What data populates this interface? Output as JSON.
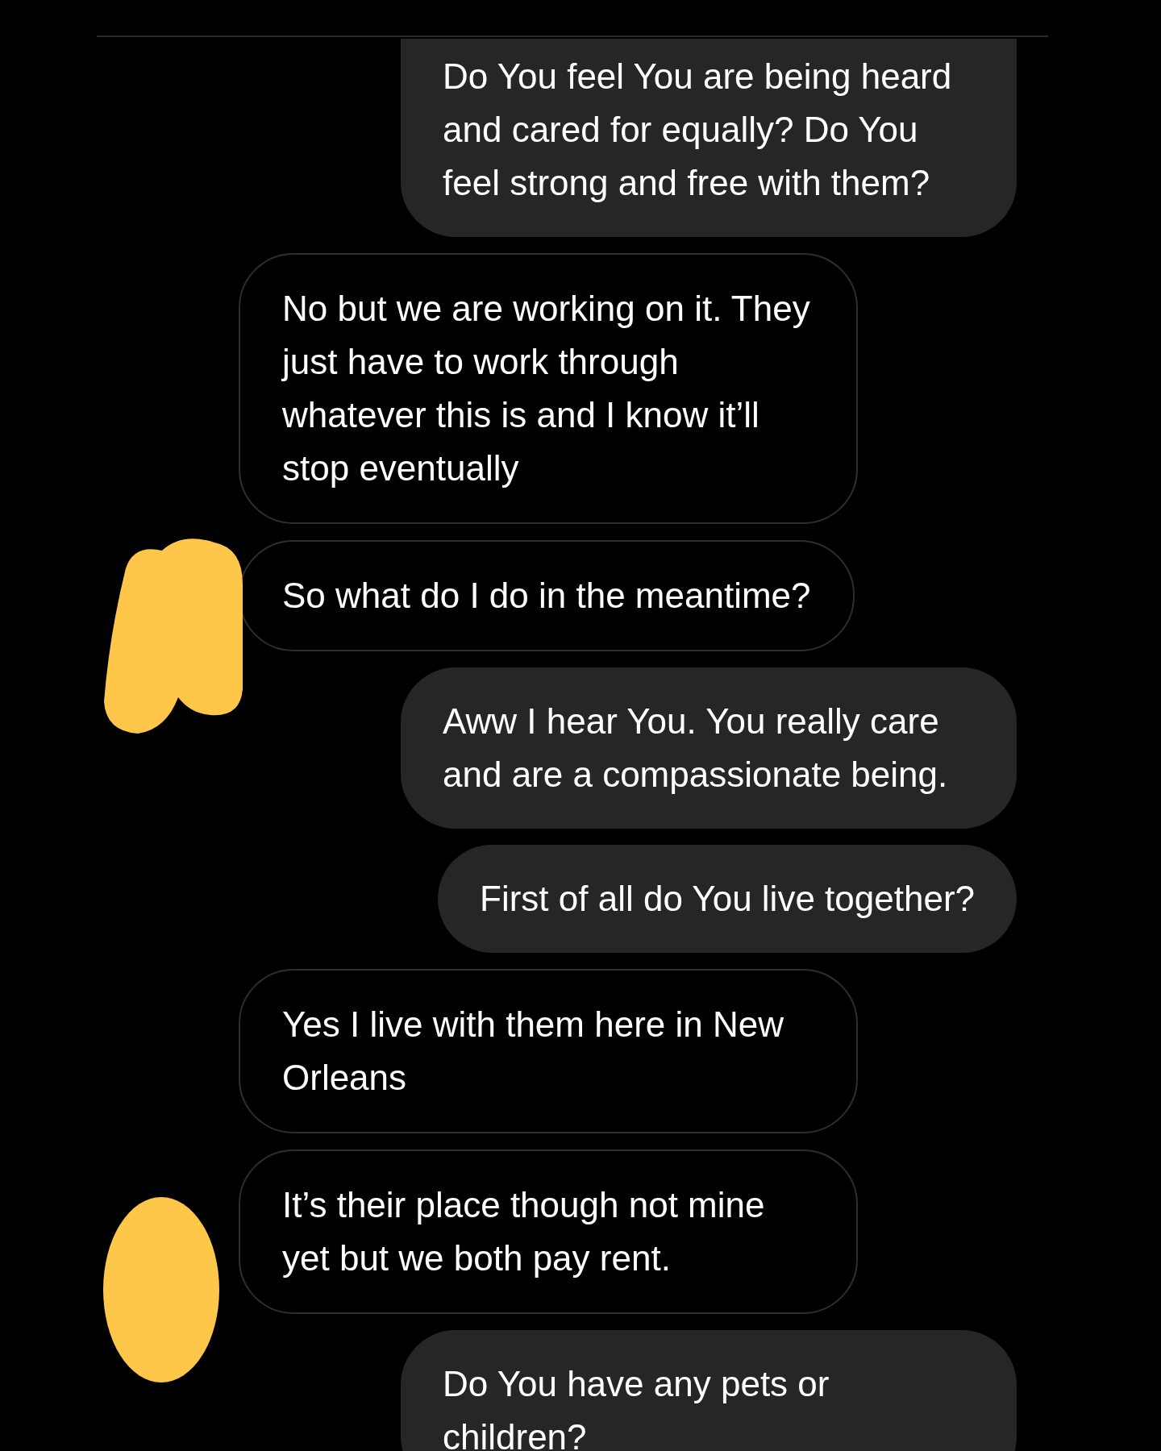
{
  "messages": [
    {
      "kind": "sent",
      "text": "Do You feel You are being heard and cared for equally? Do You feel strong and free with them?"
    },
    {
      "kind": "received",
      "text": "No but we are working on it. They just have to work through whatever this is and I know it’ll stop eventually"
    },
    {
      "kind": "received",
      "text": "So what do I do in the meantime?",
      "avatar_mark": {
        "kind": "double"
      }
    },
    {
      "kind": "sent",
      "text": "Aww I hear You. You really care and are a compassionate being."
    },
    {
      "kind": "sent",
      "text": "First of all do You live together?"
    },
    {
      "kind": "received",
      "text": "Yes I live with them here in New Orleans"
    },
    {
      "kind": "received",
      "text": "It’s their place though not mine yet but we both pay rent.",
      "avatar_mark": {
        "kind": "single"
      }
    },
    {
      "kind": "sent",
      "text": "Do You have any pets or children?"
    }
  ]
}
